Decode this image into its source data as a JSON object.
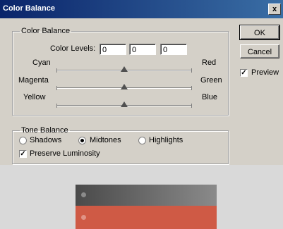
{
  "window": {
    "title": "Color Balance",
    "close_glyph": "x"
  },
  "color_balance": {
    "legend": "Color Balance",
    "levels_label": "Color Levels:",
    "levels": [
      "0",
      "0",
      "0"
    ],
    "sliders": [
      {
        "left": "Cyan",
        "right": "Red",
        "value": 0
      },
      {
        "left": "Magenta",
        "right": "Green",
        "value": 0
      },
      {
        "left": "Yellow",
        "right": "Blue",
        "value": 0
      }
    ]
  },
  "buttons": {
    "ok": "OK",
    "cancel": "Cancel"
  },
  "preview": {
    "label": "Preview",
    "checked": true
  },
  "tone_balance": {
    "legend": "Tone Balance",
    "options": [
      "Shadows",
      "Midtones",
      "Highlights"
    ],
    "selected": "Midtones",
    "preserve_label": "Preserve Luminosity",
    "preserve_checked": true
  },
  "check_glyph": "✓",
  "colors": {
    "titlebar": "#0a246a",
    "swatch_gray": "#6a6a6a",
    "swatch_red": "#cf5a45"
  }
}
